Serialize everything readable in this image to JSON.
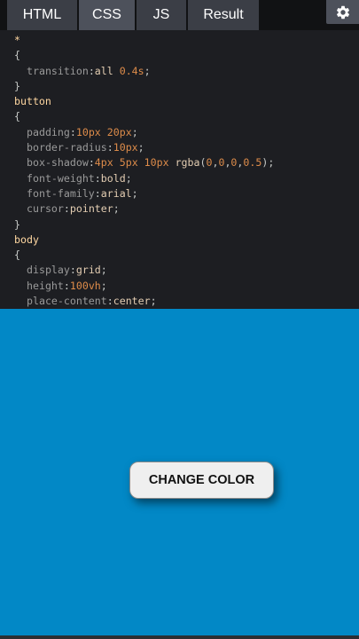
{
  "tabs": [
    {
      "label": "HTML",
      "active": false
    },
    {
      "label": "CSS",
      "active": true
    },
    {
      "label": "JS",
      "active": false
    },
    {
      "label": "Result",
      "active": false
    }
  ],
  "settings": {
    "icon": "gear-icon"
  },
  "code": {
    "l1": {
      "sel": "*"
    },
    "l2": {
      "brace": "{"
    },
    "l3": {
      "prop": "transition",
      "colon": ":",
      "val": "all ",
      "num": "0.4s",
      "semi": ";"
    },
    "l4": {
      "brace": "}"
    },
    "l5": {
      "sel": "button"
    },
    "l6": {
      "brace": "{"
    },
    "l7": {
      "prop": "padding",
      "colon": ":",
      "num1": "10px",
      "sp": " ",
      "num2": "20px",
      "semi": ";"
    },
    "l8": {
      "prop": "border-radius",
      "colon": ":",
      "num": "10px",
      "semi": ";"
    },
    "l9": {
      "prop": "box-shadow",
      "colon": ":",
      "num1": "4px",
      "num2": "5px",
      "num3": "10px",
      "fn": "rgba",
      "open": "(",
      "a": "0",
      "b": "0",
      "c": "0",
      "d": "0.5",
      "close": ")",
      "semi": ";",
      "comma": ",",
      "sp": " "
    },
    "l10": {
      "prop": "font-weight",
      "colon": ":",
      "val": "bold",
      "semi": ";"
    },
    "l11": {
      "prop": "font-family",
      "colon": ":",
      "val": "arial",
      "semi": ";"
    },
    "l12": {
      "prop": "cursor",
      "colon": ":",
      "val": "pointer",
      "semi": ";"
    },
    "l13": {
      "brace": "}"
    },
    "l14": {
      "sel": "body"
    },
    "l15": {
      "brace": "{"
    },
    "l16": {
      "prop": "display",
      "colon": ":",
      "val": "grid",
      "semi": ";"
    },
    "l17": {
      "prop": "height",
      "colon": ":",
      "num": "100vh",
      "semi": ";"
    },
    "l18": {
      "prop": "place-content",
      "colon": ":",
      "val": "center",
      "semi": ";"
    }
  },
  "result": {
    "button_label": "CHANGE COLOR",
    "background_color": "#0288c6"
  },
  "colors": {
    "tab_active": "#4d515b",
    "tab_inactive": "#3b3e46",
    "editor_bg": "#1d1e22",
    "number": "#de8c4a"
  }
}
